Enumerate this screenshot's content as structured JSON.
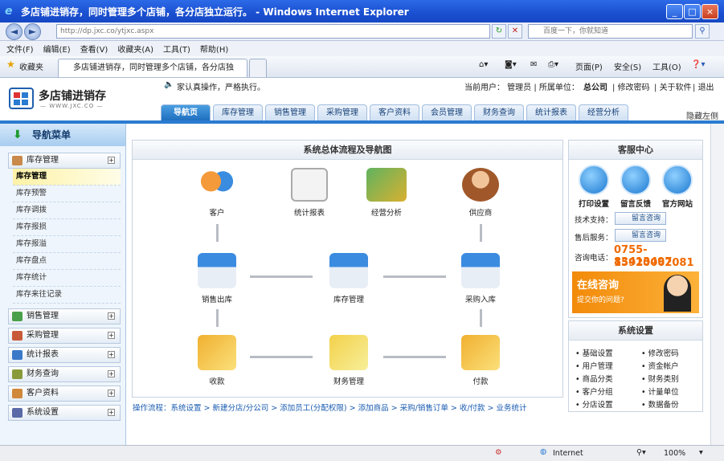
{
  "window": {
    "title": "多店铺进销存，同时管理多个店铺，各分店独立运行。 - Windows Internet Explorer"
  },
  "address": {
    "url": "http://dp.jxc.co/ytjxc.aspx",
    "search_placeholder": "百度一下，你就知道"
  },
  "menu": [
    "文件(F)",
    "编辑(E)",
    "查看(V)",
    "收藏夹(A)",
    "工具(T)",
    "帮助(H)"
  ],
  "favbar": {
    "favorites": "收藏夹",
    "tab": "多店铺进销存，同时管理多个店铺，各分店独立...",
    "page": "页面(P)",
    "safety": "安全(S)",
    "tools": "工具(O)"
  },
  "header": {
    "logo_title": "多店铺进销存",
    "logo_sub": "— WWW.JXC.CO —",
    "notice": "家认真操作，严格执行。",
    "user_info": "当前用户： 管理员 | 所属单位：",
    "company": "总公司",
    "links": [
      "修改密码",
      "关于软件",
      "退出"
    ],
    "hide_left": "隐藏左侧"
  },
  "tabs": [
    "导航页",
    "库存管理",
    "销售管理",
    "采购管理",
    "客户资料",
    "会员管理",
    "财务查询",
    "统计报表",
    "经营分析"
  ],
  "sidebar": {
    "title": "导航菜单",
    "group1": "库存管理",
    "items": [
      "库存管理",
      "库存预警",
      "库存调拨",
      "库存报损",
      "库存报溢",
      "库存盘点",
      "库存统计",
      "库存来往记录"
    ],
    "groups": [
      "销售管理",
      "采购管理",
      "统计报表",
      "财务查询",
      "客户资料",
      "系统设置"
    ]
  },
  "flow": {
    "title": "系统总体流程及导航图",
    "nodes": [
      "客户",
      "统计报表",
      "经营分析",
      "供应商",
      "销售出库",
      "库存管理",
      "采购入库",
      "收款",
      "财务管理",
      "付款"
    ],
    "footer": "操作流程：系统设置 > 新建分店/分公司 > 添加员工(分配权限) > 添加商品 > 采购/销售订单 > 收/付款 > 业务统计"
  },
  "service": {
    "title": "客服中心",
    "buttons": [
      "打印设置",
      "留言反馈",
      "官方网站"
    ],
    "tech": "技术支持：",
    "after": "售后服务：",
    "consult": "留言咨询",
    "phone_label": "咨询电话：",
    "phone1": "0755-83413497",
    "phone2": "15920062081",
    "online": "在线咨询",
    "online_sub": "提交你的问题?"
  },
  "settings": {
    "title": "系统设置",
    "items": [
      "基础设置",
      "修改密码",
      "用户管理",
      "资金帐户",
      "商品分类",
      "财务类别",
      "客户分组",
      "计量单位",
      "分店设置",
      "数据备份"
    ]
  },
  "status": {
    "zone": "Internet",
    "zoom": "100%"
  }
}
